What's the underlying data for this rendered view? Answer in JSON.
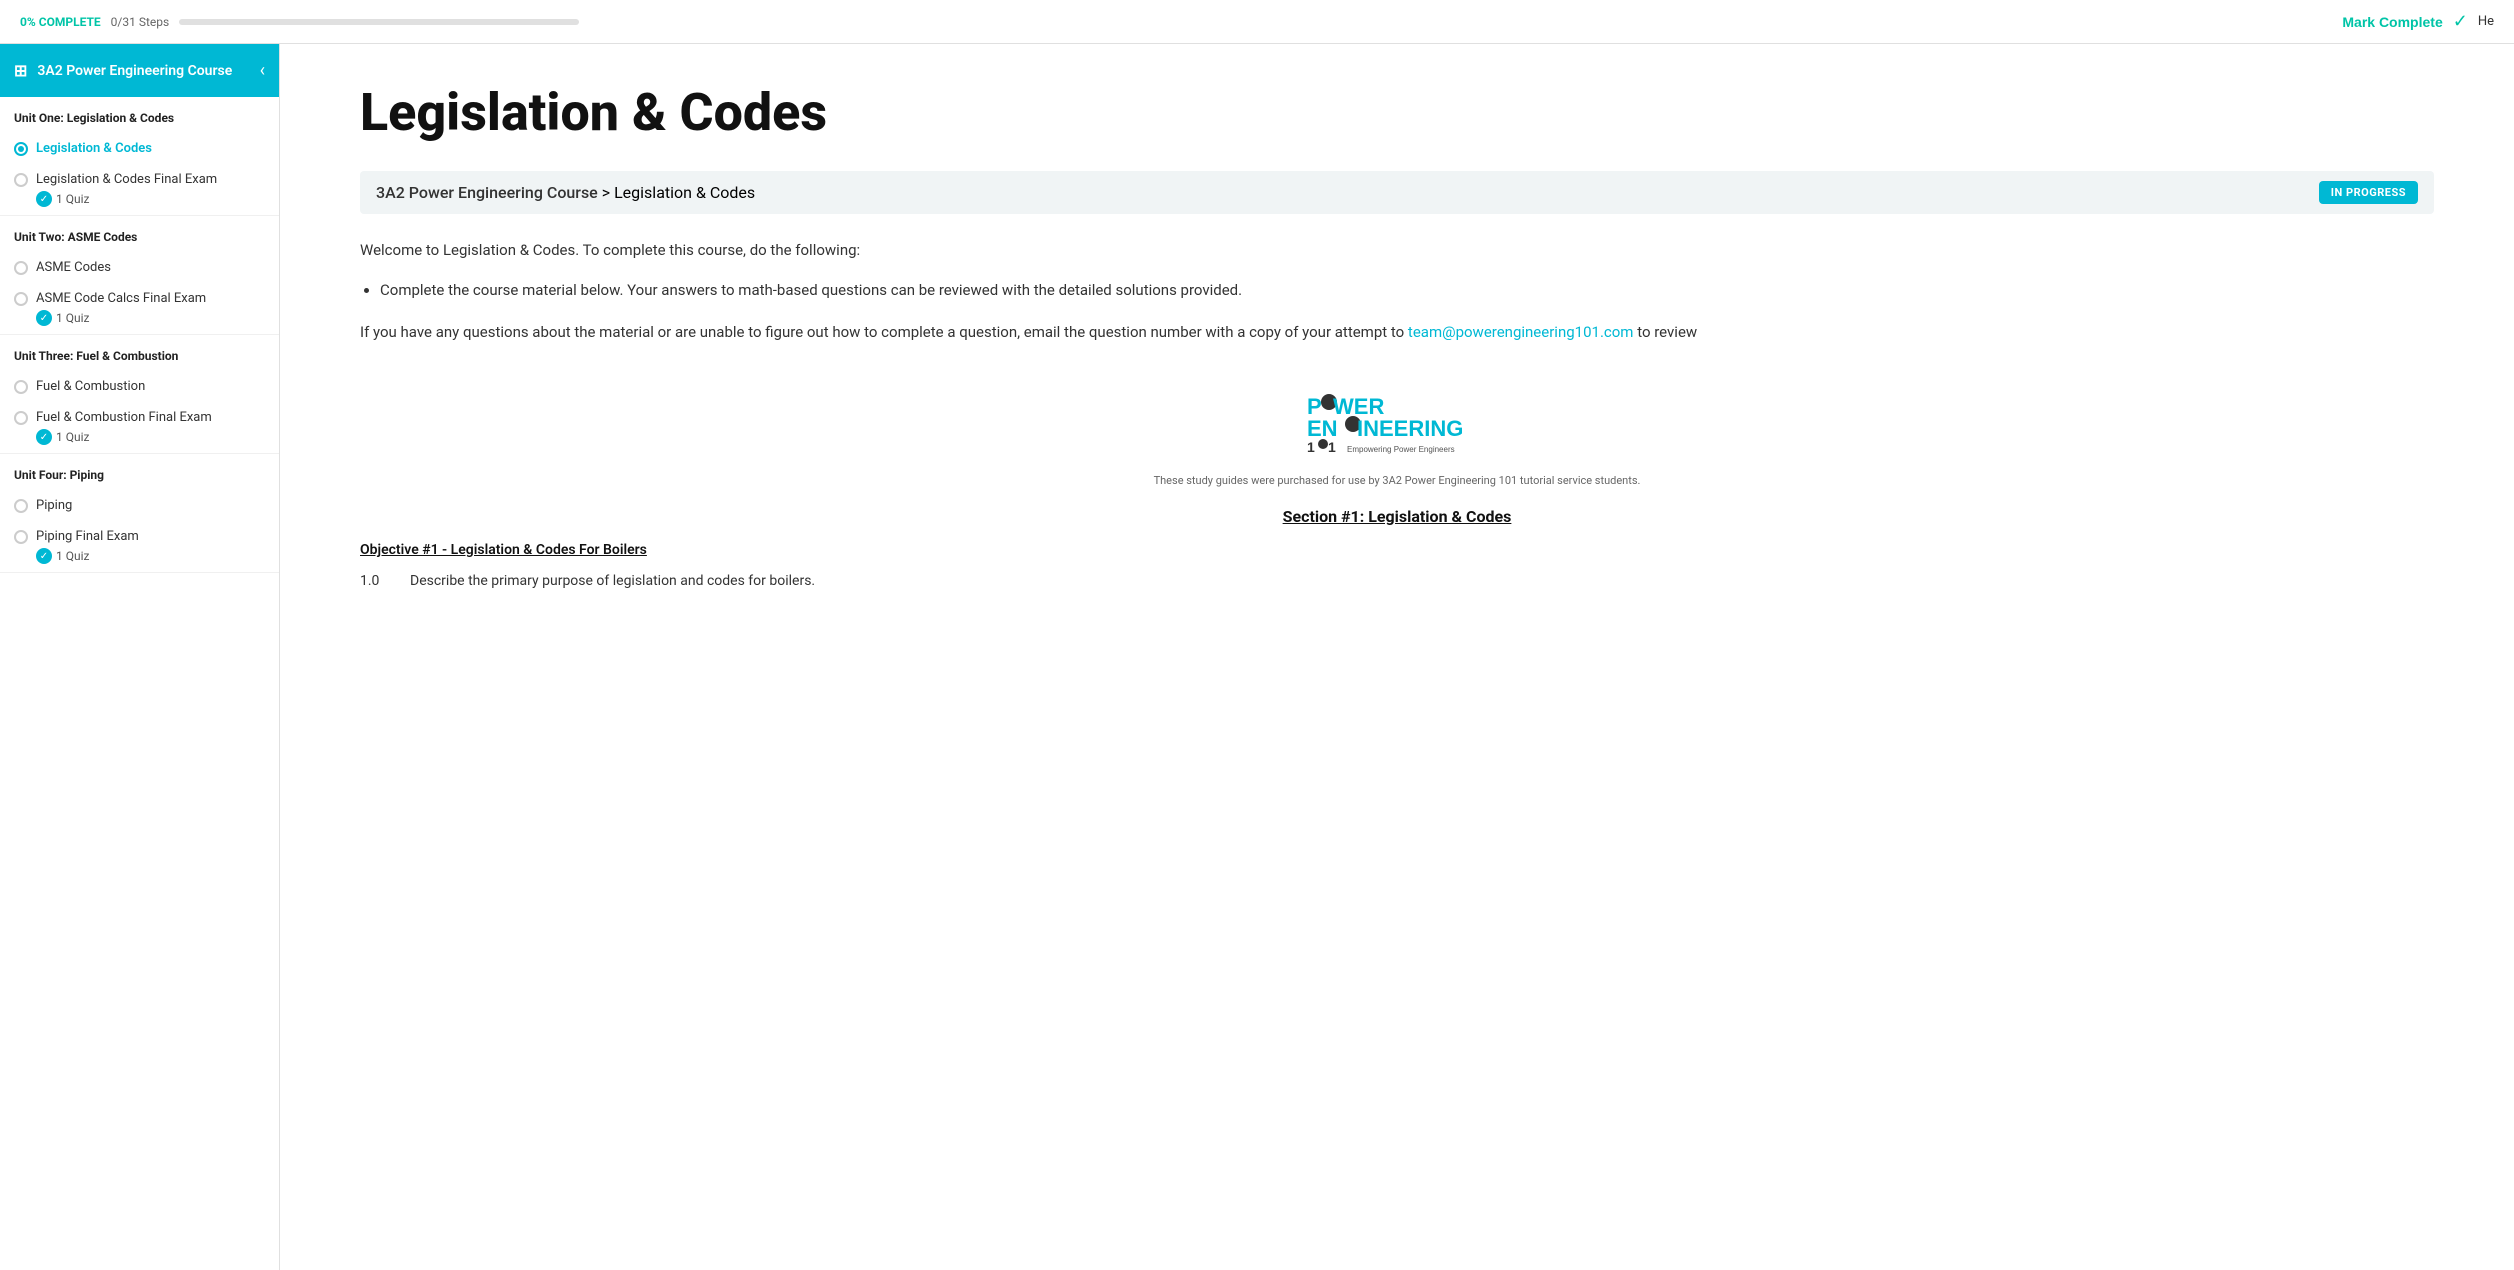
{
  "topbar": {
    "progress_percent": "0%",
    "progress_label": "0% COMPLETE",
    "progress_steps": "0/31 Steps",
    "progress_fill_width": "0%",
    "mark_complete_label": "Mark Complete",
    "he_text": "He",
    "check_symbol": "✓"
  },
  "sidebar": {
    "course_title": "3A2 Power Engineering Course",
    "collapse_icon": "‹",
    "units": [
      {
        "title": "Unit One: Legislation & Codes",
        "lessons": [
          {
            "name": "Legislation & Codes",
            "active": true,
            "has_quiz": false
          },
          {
            "name": "Legislation & Codes Final Exam",
            "active": false,
            "has_quiz": true,
            "quiz_label": "1 Quiz"
          }
        ]
      },
      {
        "title": "Unit Two: ASME Codes",
        "lessons": [
          {
            "name": "ASME Codes",
            "active": false,
            "has_quiz": false
          },
          {
            "name": "ASME Code Calcs Final Exam",
            "active": false,
            "has_quiz": true,
            "quiz_label": "1 Quiz"
          }
        ]
      },
      {
        "title": "Unit Three: Fuel & Combustion",
        "lessons": [
          {
            "name": "Fuel & Combustion",
            "active": false,
            "has_quiz": false
          },
          {
            "name": "Fuel & Combustion Final Exam",
            "active": false,
            "has_quiz": true,
            "quiz_label": "1 Quiz"
          }
        ]
      },
      {
        "title": "Unit Four: Piping",
        "lessons": [
          {
            "name": "Piping",
            "active": false,
            "has_quiz": false
          },
          {
            "name": "Piping Final Exam",
            "active": false,
            "has_quiz": true,
            "quiz_label": "1 Quiz"
          }
        ]
      }
    ]
  },
  "content": {
    "page_title": "Legislation & Codes",
    "breadcrumb_course": "3A2 Power Engineering Course",
    "breadcrumb_separator": " > ",
    "breadcrumb_current": "Legislation & Codes",
    "status_badge": "IN PROGRESS",
    "welcome_text": "Welcome to Legislation & Codes. To complete this course, do the following:",
    "bullet_1": "Complete the course material below. Your answers to math-based questions can be reviewed with the detailed solutions provided.",
    "email_prefix": "If you have any questions about the material or are unable to figure out how to complete a question, email the question number with a copy of your attempt to ",
    "email_link": "team@powerengineering101.com",
    "email_suffix": " to review",
    "logo_text_1": "P",
    "logo_text_2": "WER",
    "logo_line2": "EN",
    "logo_gear": "⚙",
    "logo_line2b": "INEERING",
    "logo_line3": "1",
    "logo_gear2": "⚙",
    "logo_line3b": "1",
    "logo_tagline": "Empowering Power Engineers",
    "study_guide_note": "These study guides were purchased for use by 3A2 Power Engineering 101 tutorial service students.",
    "section_heading": "Section #1: Legislation & Codes",
    "objective_heading": "Objective #1 - Legislation & Codes For Boilers",
    "item_1_number": "1.0",
    "item_1_text": "Describe the primary purpose of legislation and codes for boilers."
  }
}
